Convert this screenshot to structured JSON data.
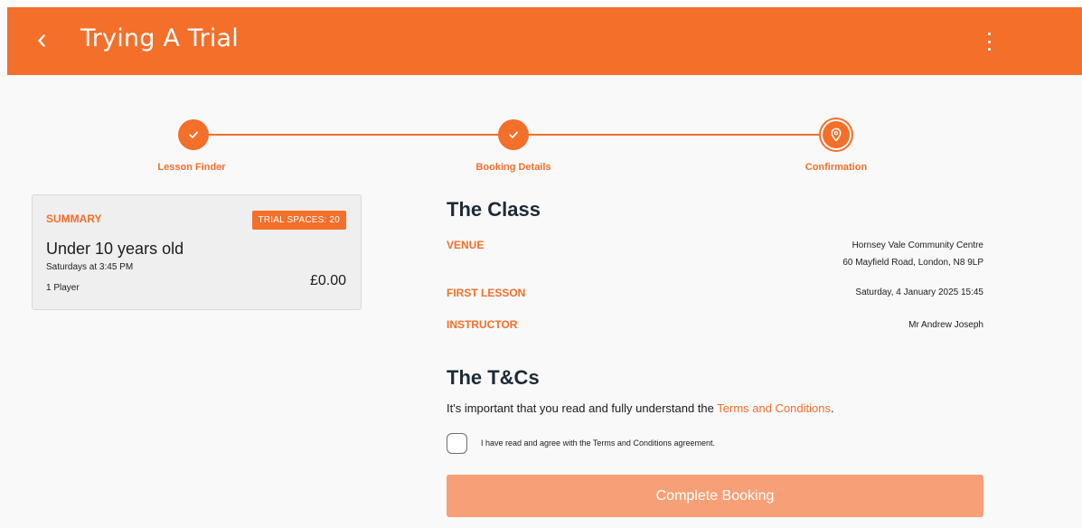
{
  "app": {
    "title": "Trying A Trial"
  },
  "stepper": {
    "steps": [
      {
        "label": "Lesson Finder",
        "status": "complete"
      },
      {
        "label": "Booking Details",
        "status": "complete"
      },
      {
        "label": "Confirmation",
        "status": "current"
      }
    ]
  },
  "summary": {
    "heading": "SUMMARY",
    "badge": "TRIAL SPACES: 20",
    "class_name": "Under 10 years old",
    "class_time": "Saturdays at 3:45 PM",
    "players": "1 Player",
    "price": "£0.00"
  },
  "class_section": {
    "title": "The Class",
    "venue_label": "VENUE",
    "venue_line1": "Hornsey Vale Community Centre",
    "venue_line2": "60 Mayfield Road, London, N8 9LP",
    "first_lesson_label": "FIRST LESSON",
    "first_lesson_value": "Saturday, 4 January 2025 15:45",
    "instructor_label": "INSTRUCTOR",
    "instructor_value": "Mr Andrew Joseph"
  },
  "tcs": {
    "title": "The T&Cs",
    "intro": "It's important that you read and fully understand the ",
    "link": "Terms and Conditions",
    "intro_end": ".",
    "agree_label": "I have read and agree with the Terms and Conditions agreement.",
    "agreed": false
  },
  "actions": {
    "complete_label": "Complete Booking"
  },
  "colors": {
    "brand": "#f36f2a",
    "button_disabled": "#f7a077",
    "heading": "#1e2a36"
  }
}
